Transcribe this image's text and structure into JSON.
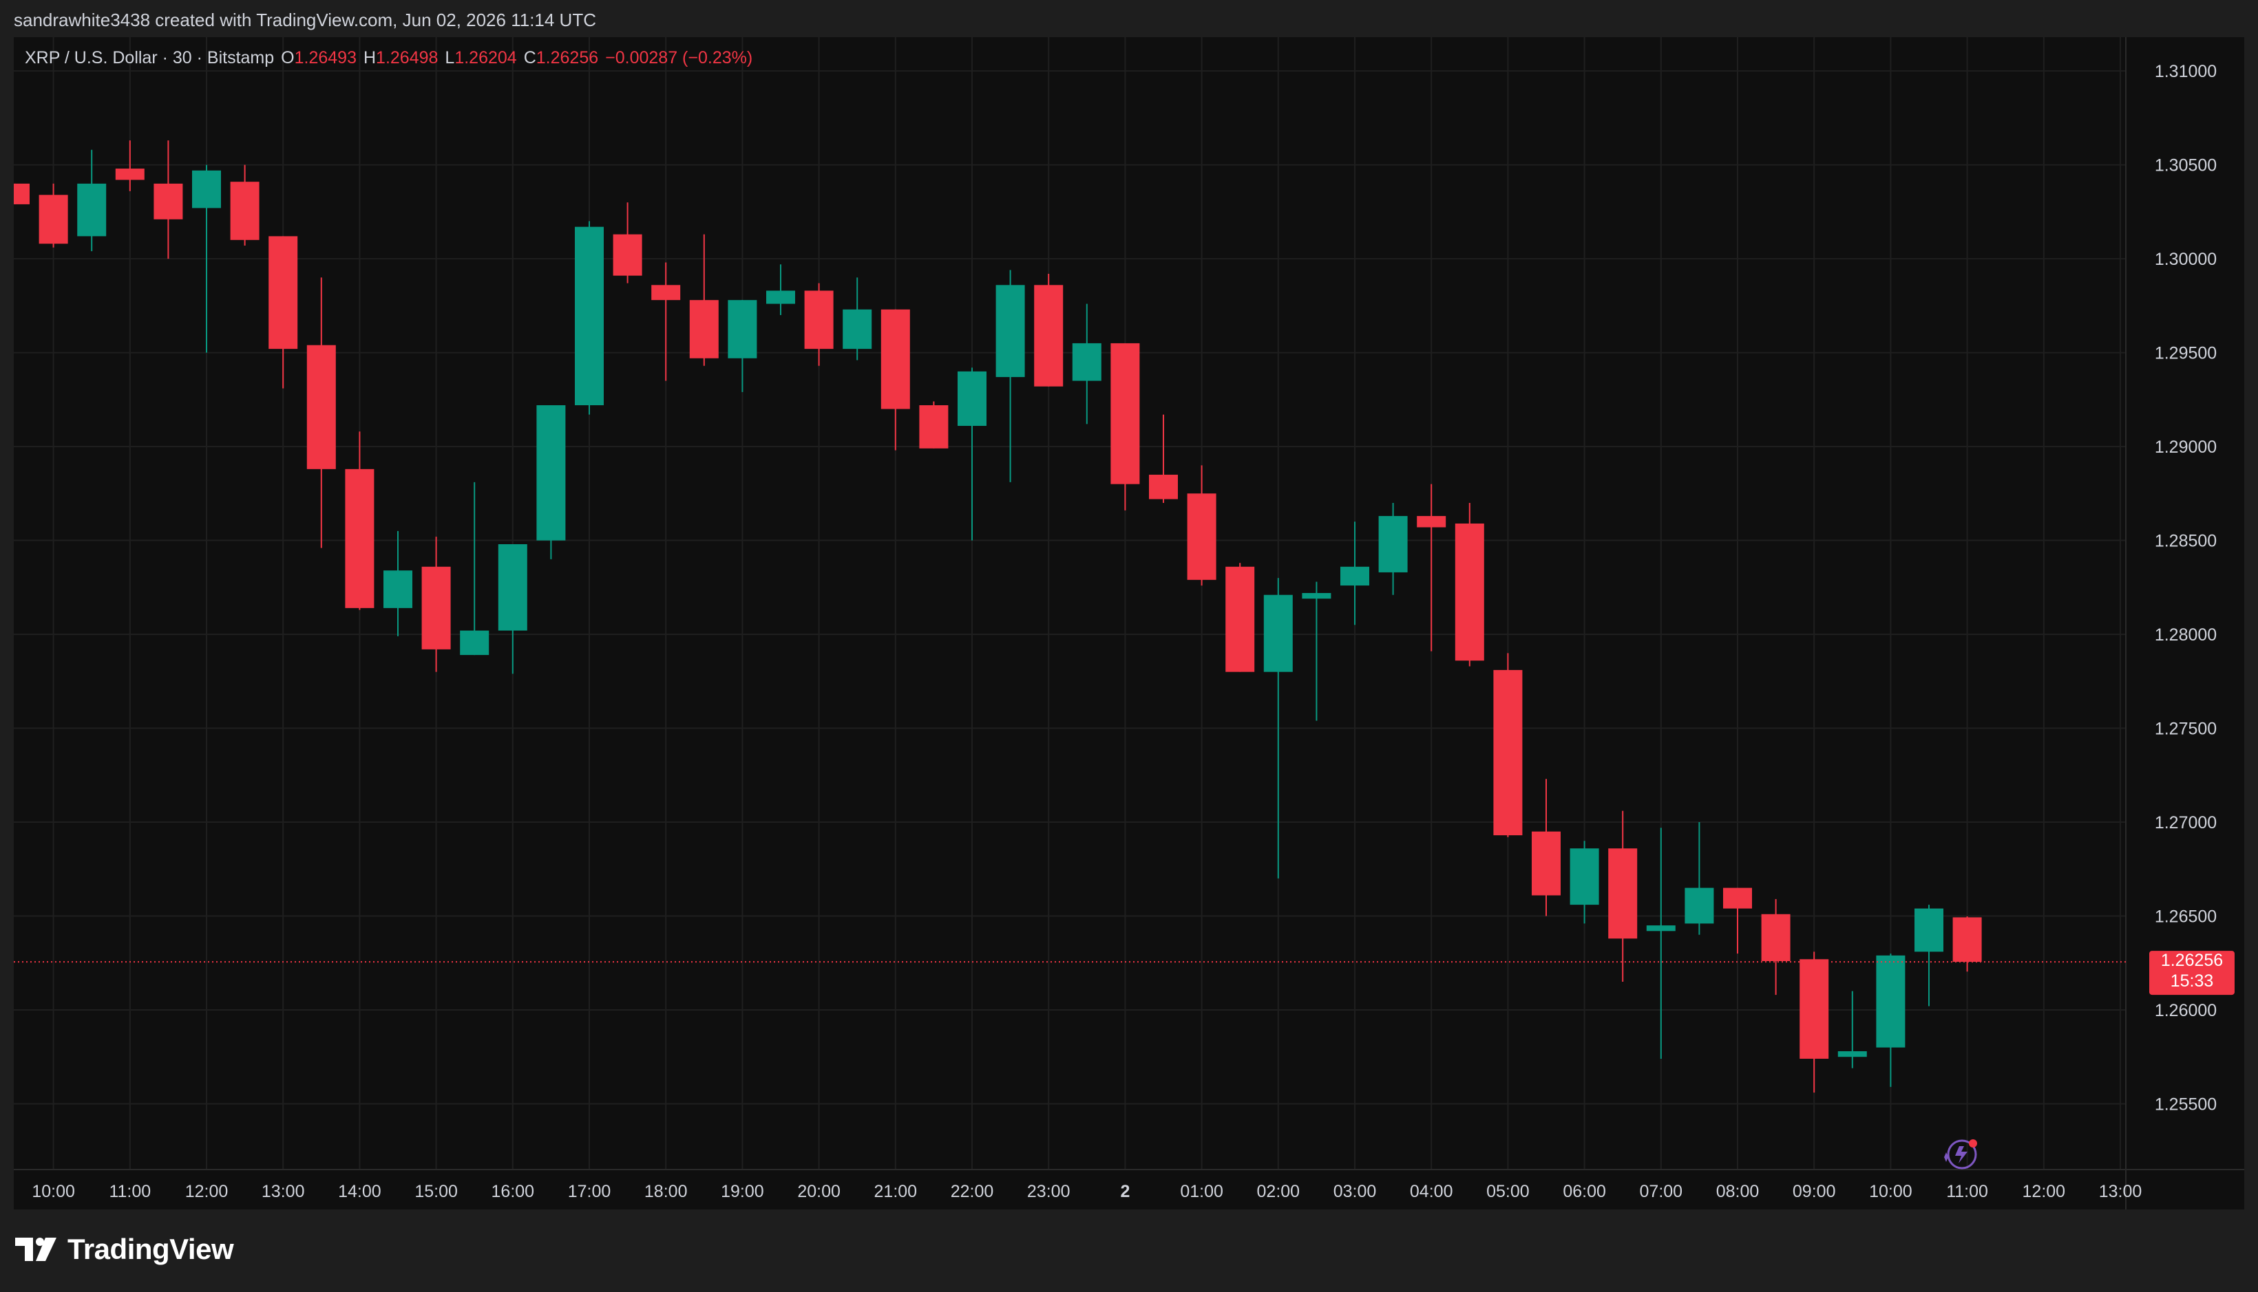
{
  "caption": "sandrawhite3438 created with TradingView.com, Jun 02, 2026 11:14 UTC",
  "legend": {
    "symbol": "XRP / U.S. Dollar · 30 · Bitstamp",
    "o_label": "O",
    "o_value": "1.26493",
    "h_label": "H",
    "h_value": "1.26498",
    "l_label": "L",
    "l_value": "1.26204",
    "c_label": "C",
    "c_value": "1.26256",
    "change": "−0.00287 (−0.23%)"
  },
  "price_tag": {
    "price": "1.26256",
    "countdown": "15:33"
  },
  "brand": "TradingView",
  "colors": {
    "up": "#089981",
    "down": "#f23645",
    "background": "#0f0f0f",
    "grid": "#1f1f1f",
    "text": "#d1d4dc"
  },
  "icons": [
    "tradingview-logo-icon",
    "ai-assistant-icon"
  ],
  "chart_data": {
    "type": "candlestick",
    "interval_minutes": 30,
    "ylim": [
      1.2515,
      1.3118
    ],
    "grid": true,
    "y_ticks": [
      "1.31000",
      "1.30500",
      "1.30000",
      "1.29500",
      "1.29000",
      "1.28500",
      "1.28000",
      "1.27500",
      "1.27000",
      "1.26500",
      "1.26000",
      "1.25500"
    ],
    "x_ticks": [
      "10:00",
      "11:00",
      "12:00",
      "13:00",
      "14:00",
      "15:00",
      "16:00",
      "17:00",
      "18:00",
      "19:00",
      "20:00",
      "21:00",
      "22:00",
      "23:00",
      "2",
      "01:00",
      "02:00",
      "03:00",
      "04:00",
      "05:00",
      "06:00",
      "07:00",
      "08:00",
      "09:00",
      "10:00",
      "11:00",
      "12:00",
      "13:00"
    ],
    "last_price": 1.26256,
    "candles": [
      {
        "t": "09:30",
        "o": 1.304,
        "h": 1.304,
        "l": 1.3029,
        "c": 1.3029
      },
      {
        "t": "10:00",
        "o": 1.3034,
        "h": 1.304,
        "l": 1.3006,
        "c": 1.3008
      },
      {
        "t": "10:30",
        "o": 1.3012,
        "h": 1.3058,
        "l": 1.3004,
        "c": 1.304
      },
      {
        "t": "11:00",
        "o": 1.3048,
        "h": 1.3063,
        "l": 1.3036,
        "c": 1.3042
      },
      {
        "t": "11:30",
        "o": 1.304,
        "h": 1.3063,
        "l": 1.3,
        "c": 1.3021
      },
      {
        "t": "12:00",
        "o": 1.3027,
        "h": 1.305,
        "l": 1.295,
        "c": 1.3047
      },
      {
        "t": "12:30",
        "o": 1.3041,
        "h": 1.305,
        "l": 1.3007,
        "c": 1.301
      },
      {
        "t": "13:00",
        "o": 1.3012,
        "h": 1.3012,
        "l": 1.2931,
        "c": 1.2952
      },
      {
        "t": "13:30",
        "o": 1.2954,
        "h": 1.299,
        "l": 1.2846,
        "c": 1.2888
      },
      {
        "t": "14:00",
        "o": 1.2888,
        "h": 1.2908,
        "l": 1.2813,
        "c": 1.2814
      },
      {
        "t": "14:30",
        "o": 1.2814,
        "h": 1.2855,
        "l": 1.2799,
        "c": 1.2834
      },
      {
        "t": "15:00",
        "o": 1.2836,
        "h": 1.2852,
        "l": 1.278,
        "c": 1.2792
      },
      {
        "t": "15:30",
        "o": 1.2789,
        "h": 1.2881,
        "l": 1.2789,
        "c": 1.2802
      },
      {
        "t": "16:00",
        "o": 1.2802,
        "h": 1.2848,
        "l": 1.2779,
        "c": 1.2848
      },
      {
        "t": "16:30",
        "o": 1.285,
        "h": 1.2922,
        "l": 1.284,
        "c": 1.2922
      },
      {
        "t": "17:00",
        "o": 1.2922,
        "h": 1.302,
        "l": 1.2917,
        "c": 1.3017
      },
      {
        "t": "17:30",
        "o": 1.3013,
        "h": 1.303,
        "l": 1.2987,
        "c": 1.2991
      },
      {
        "t": "18:00",
        "o": 1.2986,
        "h": 1.2998,
        "l": 1.2935,
        "c": 1.2978
      },
      {
        "t": "18:30",
        "o": 1.2978,
        "h": 1.3013,
        "l": 1.2943,
        "c": 1.2947
      },
      {
        "t": "19:00",
        "o": 1.2947,
        "h": 1.2978,
        "l": 1.2929,
        "c": 1.2978
      },
      {
        "t": "19:30",
        "o": 1.2976,
        "h": 1.2997,
        "l": 1.297,
        "c": 1.2983
      },
      {
        "t": "20:00",
        "o": 1.2983,
        "h": 1.2987,
        "l": 1.2943,
        "c": 1.2952
      },
      {
        "t": "20:30",
        "o": 1.2952,
        "h": 1.299,
        "l": 1.2946,
        "c": 1.2973
      },
      {
        "t": "21:00",
        "o": 1.2973,
        "h": 1.2973,
        "l": 1.2898,
        "c": 1.292
      },
      {
        "t": "21:30",
        "o": 1.2922,
        "h": 1.2924,
        "l": 1.2899,
        "c": 1.2899
      },
      {
        "t": "22:00",
        "o": 1.2911,
        "h": 1.2942,
        "l": 1.285,
        "c": 1.294
      },
      {
        "t": "22:30",
        "o": 1.2937,
        "h": 1.2994,
        "l": 1.2881,
        "c": 1.2986
      },
      {
        "t": "23:00",
        "o": 1.2986,
        "h": 1.2992,
        "l": 1.2932,
        "c": 1.2932
      },
      {
        "t": "23:30",
        "o": 1.2935,
        "h": 1.2976,
        "l": 1.2912,
        "c": 1.2955
      },
      {
        "t": "00:00",
        "o": 1.2955,
        "h": 1.2955,
        "l": 1.2866,
        "c": 1.288
      },
      {
        "t": "00:30",
        "o": 1.2885,
        "h": 1.2917,
        "l": 1.287,
        "c": 1.2872
      },
      {
        "t": "01:00",
        "o": 1.2875,
        "h": 1.289,
        "l": 1.2826,
        "c": 1.2829
      },
      {
        "t": "01:30",
        "o": 1.2836,
        "h": 1.2838,
        "l": 1.278,
        "c": 1.278
      },
      {
        "t": "02:00",
        "o": 1.278,
        "h": 1.283,
        "l": 1.267,
        "c": 1.2821
      },
      {
        "t": "02:30",
        "o": 1.2819,
        "h": 1.2828,
        "l": 1.2754,
        "c": 1.2822
      },
      {
        "t": "03:00",
        "o": 1.2826,
        "h": 1.286,
        "l": 1.2805,
        "c": 1.2836
      },
      {
        "t": "03:30",
        "o": 1.2833,
        "h": 1.287,
        "l": 1.2821,
        "c": 1.2863
      },
      {
        "t": "04:00",
        "o": 1.2863,
        "h": 1.288,
        "l": 1.2791,
        "c": 1.2857
      },
      {
        "t": "04:30",
        "o": 1.2859,
        "h": 1.287,
        "l": 1.2783,
        "c": 1.2786
      },
      {
        "t": "05:00",
        "o": 1.2781,
        "h": 1.279,
        "l": 1.2692,
        "c": 1.2693
      },
      {
        "t": "05:30",
        "o": 1.2695,
        "h": 1.2723,
        "l": 1.265,
        "c": 1.2661
      },
      {
        "t": "06:00",
        "o": 1.2656,
        "h": 1.269,
        "l": 1.2646,
        "c": 1.2686
      },
      {
        "t": "06:30",
        "o": 1.2686,
        "h": 1.2706,
        "l": 1.2615,
        "c": 1.2638
      },
      {
        "t": "07:00",
        "o": 1.2642,
        "h": 1.2697,
        "l": 1.2574,
        "c": 1.2645
      },
      {
        "t": "07:30",
        "o": 1.2646,
        "h": 1.27,
        "l": 1.264,
        "c": 1.2665
      },
      {
        "t": "08:00",
        "o": 1.2665,
        "h": 1.2665,
        "l": 1.263,
        "c": 1.2654
      },
      {
        "t": "08:30",
        "o": 1.2651,
        "h": 1.2659,
        "l": 1.2608,
        "c": 1.2626
      },
      {
        "t": "09:00",
        "o": 1.2627,
        "h": 1.2631,
        "l": 1.2556,
        "c": 1.2574
      },
      {
        "t": "09:30",
        "o": 1.2575,
        "h": 1.261,
        "l": 1.2569,
        "c": 1.2578
      },
      {
        "t": "10:00",
        "o": 1.258,
        "h": 1.263,
        "l": 1.2559,
        "c": 1.2629
      },
      {
        "t": "10:30",
        "o": 1.2631,
        "h": 1.2656,
        "l": 1.2602,
        "c": 1.2654
      },
      {
        "t": "11:00",
        "o": 1.26493,
        "h": 1.26498,
        "l": 1.26204,
        "c": 1.26256
      }
    ]
  }
}
